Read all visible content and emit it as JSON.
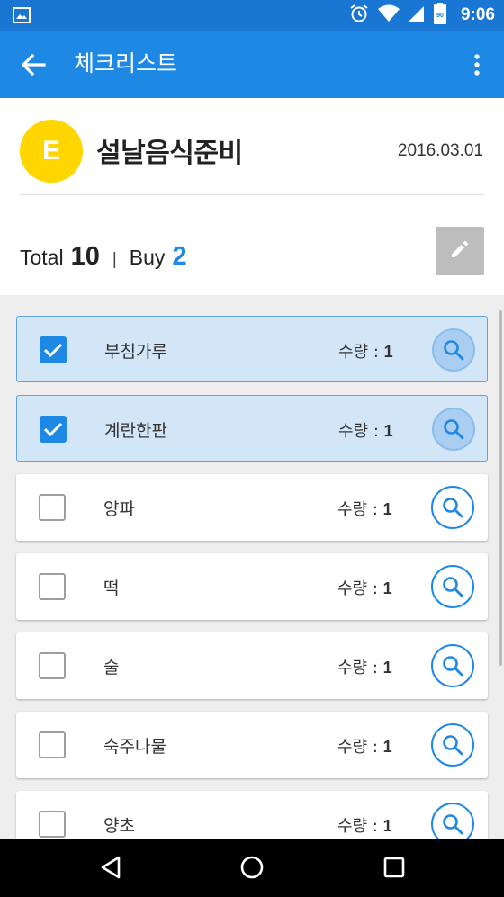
{
  "status_bar": {
    "time": "9:06",
    "icons": [
      "image-icon",
      "alarm-icon",
      "wifi-icon",
      "signal-icon",
      "battery-icon"
    ],
    "battery_level": "90"
  },
  "toolbar": {
    "title": "체크리스트",
    "back_icon": "arrow-back-icon",
    "menu_icon": "more-vert-icon"
  },
  "checklist": {
    "avatar_letter": "E",
    "title": "설날음식준비",
    "date": "2016.03.01",
    "total_label": "Total",
    "total_count": "10",
    "separator": "|",
    "buy_label": "Buy",
    "buy_count": "2",
    "edit_icon": "pencil-icon"
  },
  "items": [
    {
      "name": "부침가루",
      "qty_label": "수량 : ",
      "qty": "1",
      "checked": true
    },
    {
      "name": "계란한판",
      "qty_label": "수량 : ",
      "qty": "1",
      "checked": true
    },
    {
      "name": "양파",
      "qty_label": "수량 : ",
      "qty": "1",
      "checked": false
    },
    {
      "name": "떡",
      "qty_label": "수량 : ",
      "qty": "1",
      "checked": false
    },
    {
      "name": "술",
      "qty_label": "수량 : ",
      "qty": "1",
      "checked": false
    },
    {
      "name": "숙주나물",
      "qty_label": "수량 : ",
      "qty": "1",
      "checked": false
    },
    {
      "name": "양초",
      "qty_label": "수량 : ",
      "qty": "1",
      "checked": false
    }
  ],
  "colors": {
    "primary": "#1e88e5",
    "status_bar": "#1976d2",
    "avatar": "#ffd600",
    "checked_row": "#d3e6f8"
  }
}
